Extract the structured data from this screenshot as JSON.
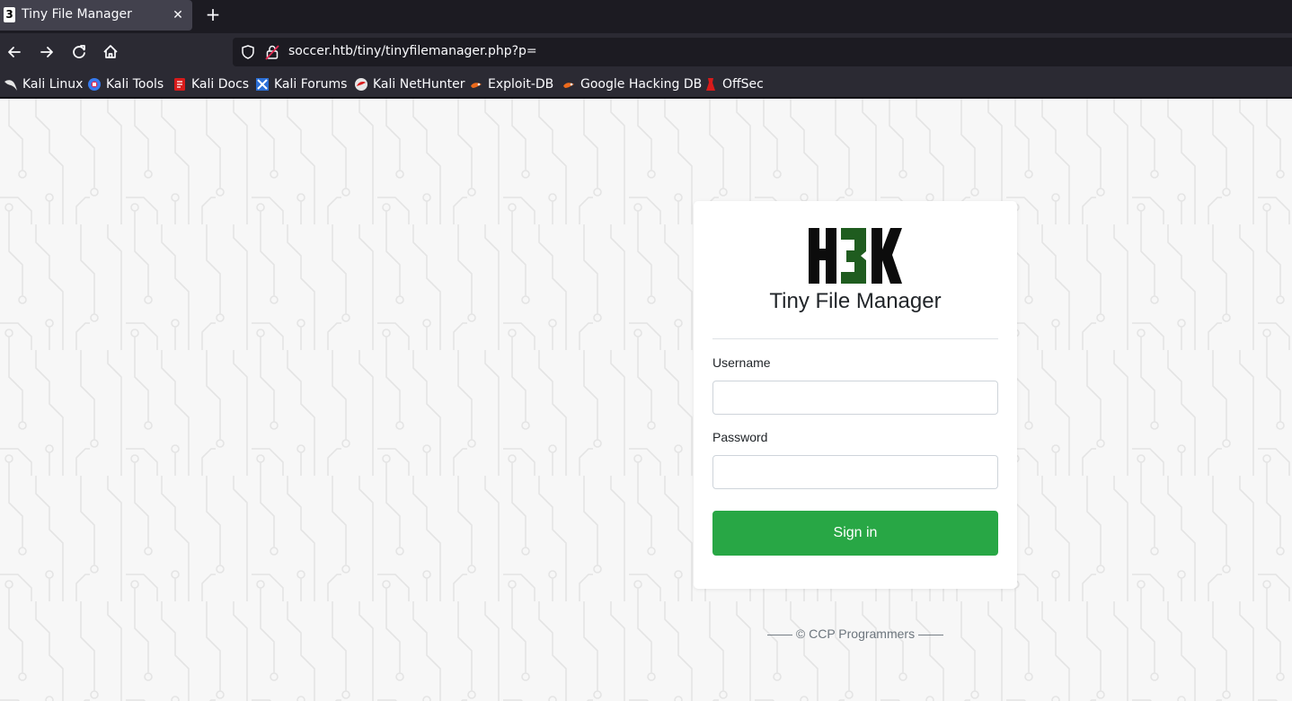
{
  "browser": {
    "tab": {
      "title": "Tiny File Manager",
      "favicon_text": "3",
      "close_glyph": "✕"
    },
    "new_tab_glyph": "+",
    "url": "soccer.htb/tiny/tinyfilemanager.php?p=",
    "bookmarks": [
      {
        "label": "Kali Linux",
        "icon": "kali-dragon-icon"
      },
      {
        "label": "Kali Tools",
        "icon": "kali-tools-icon"
      },
      {
        "label": "Kali Docs",
        "icon": "kali-docs-icon"
      },
      {
        "label": "Kali Forums",
        "icon": "kali-forums-icon"
      },
      {
        "label": "Kali NetHunter",
        "icon": "kali-nethunter-icon"
      },
      {
        "label": "Exploit-DB",
        "icon": "exploit-db-icon"
      },
      {
        "label": "Google Hacking DB",
        "icon": "google-hacking-db-icon"
      },
      {
        "label": "OffSec",
        "icon": "offsec-icon"
      }
    ]
  },
  "login": {
    "logo_text": "H3K",
    "title": "Tiny File Manager",
    "username_label": "Username",
    "username_value": "",
    "password_label": "Password",
    "password_value": "",
    "submit_label": "Sign in"
  },
  "footer": {
    "text": "—— © CCP Programmers ——"
  },
  "colors": {
    "accent_green": "#28a745",
    "logo_green": "#1f5c1f",
    "page_bg": "#f7f7f7",
    "chrome_dark": "#1c1b22",
    "toolbar": "#2b2a33"
  }
}
